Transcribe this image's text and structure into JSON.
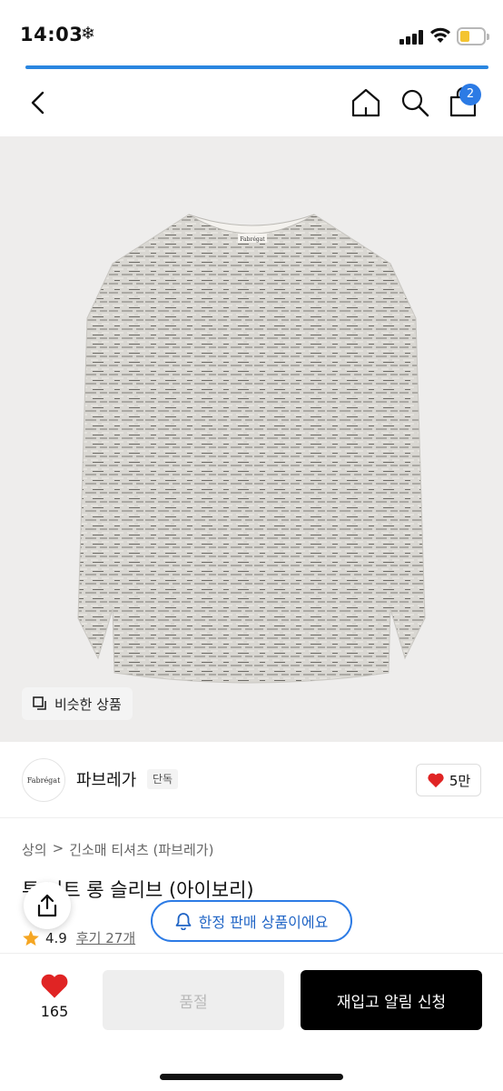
{
  "status_bar": {
    "time": "14:03",
    "extra_icon": "❄"
  },
  "nav": {
    "cart_count": "2"
  },
  "product_image": {
    "chip_label": "비슷한 상품",
    "garment_label": "Fabrégat"
  },
  "brand": {
    "logo_text": "Fabrégat",
    "name": "파브레가",
    "tag": "단독",
    "likes": "5만"
  },
  "breadcrumb": {
    "level1": "상의",
    "separator": ">",
    "level2": "긴소매 티셔츠 (파브레가)"
  },
  "product": {
    "title": "투 니트 롱 슬리브 (아이보리)",
    "rating": "4.9",
    "review_label": "후기 27개"
  },
  "floating": {
    "limited_label": "한정 판매 상품이에요"
  },
  "bottom": {
    "wish_count": "165",
    "soldout_label": "품절",
    "restock_label": "재입고 알림 신청"
  },
  "colors": {
    "accent": "#2c7be5",
    "heart": "#e02424",
    "star": "#f5a623"
  }
}
